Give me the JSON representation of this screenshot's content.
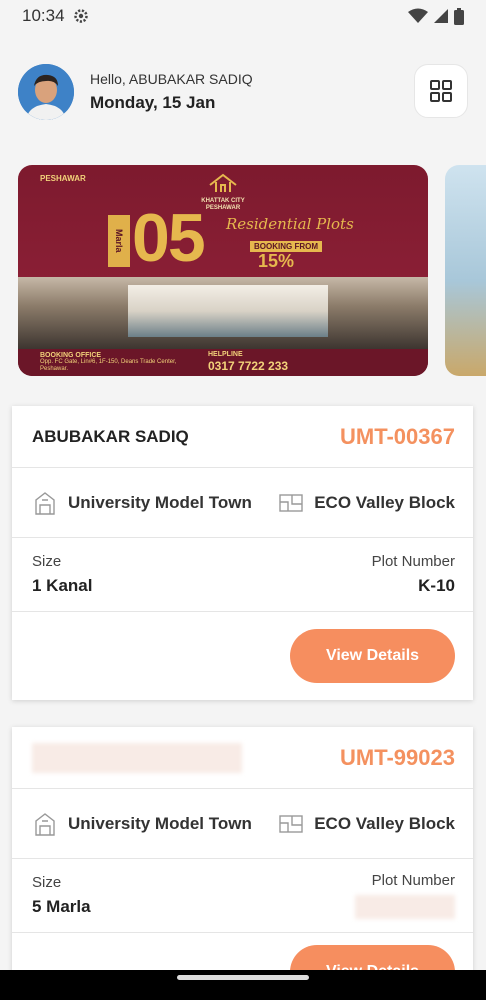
{
  "status": {
    "time": "10:34"
  },
  "header": {
    "greeting": "Hello, ABUBAKAR SADIQ",
    "date": "Monday, 15 Jan"
  },
  "banner": {
    "city": "PESHAWAR",
    "logo_text": "KHATTAK CITY PESHAWAR",
    "marla": "Marla",
    "big_number": "05",
    "script": "Residential Plots",
    "booking_from": "BOOKING FROM",
    "percent": "15%",
    "office_title": "BOOKING OFFICE",
    "office_address": "Opp. FC Gate, Lin#6, 1F-150, Deans Trade Center, Peshawar.",
    "helpline_label": "HELPLINE",
    "helpline_number": "0317 7722 233"
  },
  "cards": [
    {
      "owner": "ABUBAKAR SADIQ",
      "plot_id": "UMT-00367",
      "society": "University Model Town",
      "block": "ECO Valley Block",
      "size_label": "Size",
      "size": "1 Kanal",
      "plot_number_label": "Plot Number",
      "plot_number": "K-10",
      "button": "View Details"
    },
    {
      "owner": "",
      "plot_id": "UMT-99023",
      "society": "University Model Town",
      "block": "ECO Valley Block",
      "size_label": "Size",
      "size": "5 Marla",
      "plot_number_label": "Plot Number",
      "plot_number": "",
      "button": "View Details"
    }
  ],
  "colors": {
    "accent": "#f68e5f",
    "plot_id": "#f4915f"
  }
}
